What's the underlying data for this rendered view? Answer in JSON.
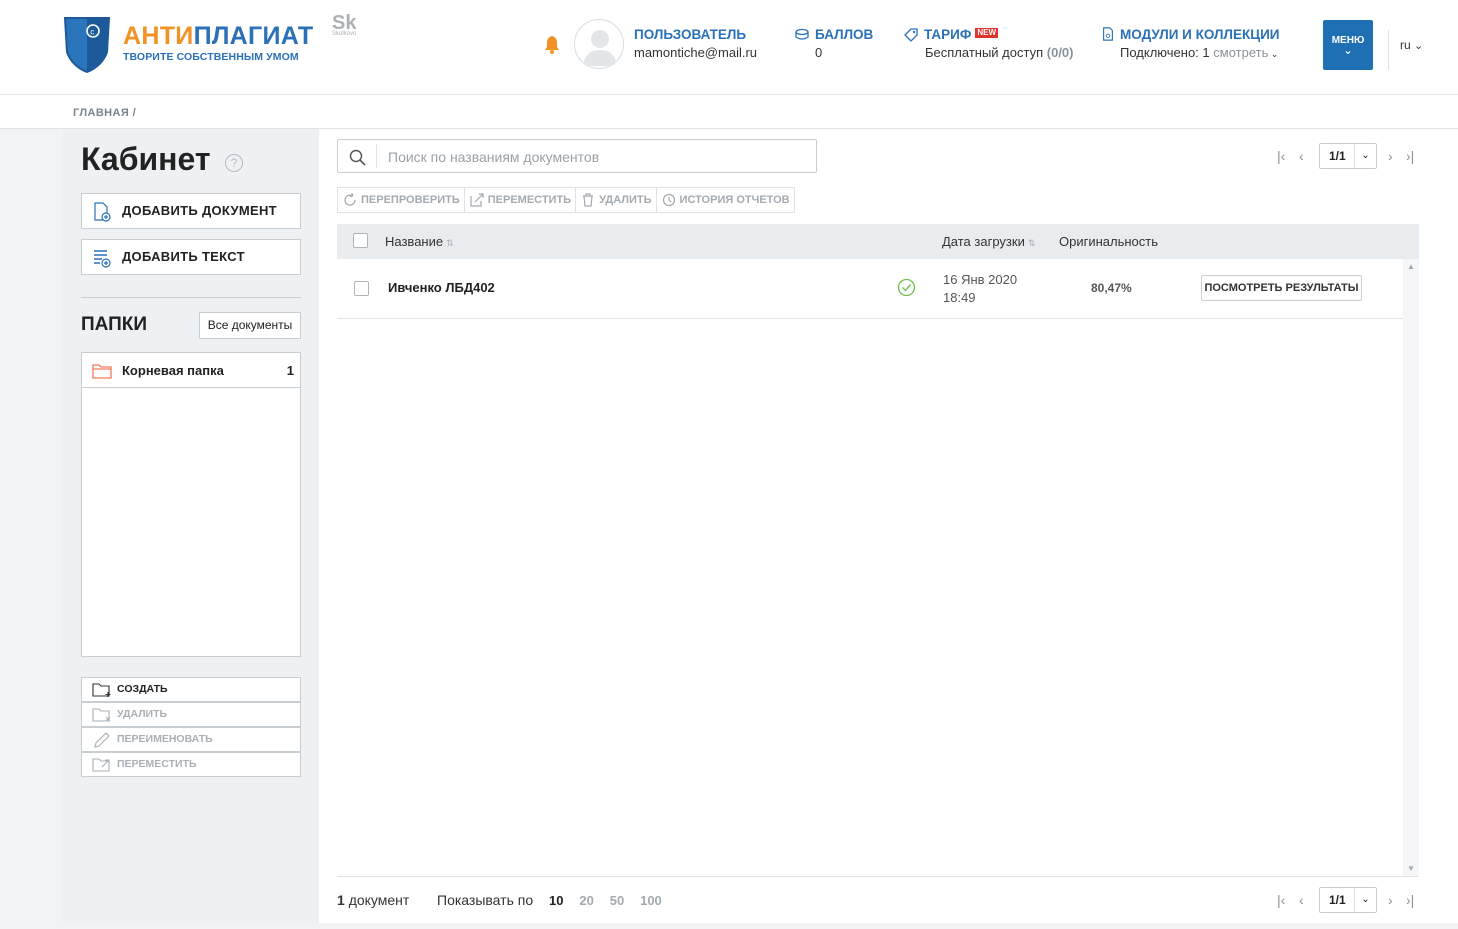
{
  "header": {
    "logo_part1": "АНТИ",
    "logo_part2": "ПЛАГИАТ",
    "logo_tagline": "ТВОРИТЕ СОБСТВЕННЫМ УМОМ",
    "skolkovo": "Sk",
    "skolkovo_sub": "Skolkovo",
    "user_label": "ПОЛЬЗОВАТЕЛЬ",
    "user_email": "mamontiche@mail.ru",
    "points_label": "БАЛЛОВ",
    "points_value": "0",
    "tariff_label": "ТАРИФ",
    "tariff_badge": "NEW",
    "tariff_value": "Бесплатный доступ",
    "tariff_count": "(0/0)",
    "modules_label": "МОДУЛИ И КОЛЛЕКЦИИ",
    "modules_value": "Подключено: 1",
    "modules_link": "смотреть",
    "menu_label": "МЕНЮ",
    "lang": "ru"
  },
  "breadcrumb": "ГЛАВНАЯ /",
  "sidebar": {
    "title": "Кабинет",
    "help": "?",
    "add_document": "ДОБАВИТЬ ДОКУМЕНТ",
    "add_text": "ДОБАВИТЬ ТЕКСТ",
    "folders_title": "ПАПКИ",
    "all_documents": "Все документы",
    "folders": [
      {
        "name": "Корневая папка",
        "count": "1"
      }
    ],
    "folder_actions": [
      "СОЗДАТЬ",
      "УДАЛИТЬ",
      "ПЕРЕИМЕНОВАТЬ",
      "ПЕРЕМЕСТИТЬ"
    ]
  },
  "main": {
    "search_placeholder": "Поиск по названиям документов",
    "page_indicator": "1/1",
    "actions": [
      "ПЕРЕПРОВЕРИТЬ",
      "ПЕРЕМЕСТИТЬ",
      "УДАЛИТЬ",
      "ИСТОРИЯ ОТЧЕТОВ"
    ],
    "columns": {
      "name": "Название",
      "date": "Дата загрузки",
      "originality": "Оригинальность"
    },
    "rows": [
      {
        "name": "Ивченко ЛБД402",
        "date": "16 Янв 2020",
        "time": "18:49",
        "originality": "80,47%",
        "button": "ПОСМОТРЕТЬ РЕЗУЛЬТАТЫ"
      }
    ],
    "footer_count_num": "1",
    "footer_count_word": "документ",
    "per_page_label": "Показывать по",
    "per_page_options": [
      "10",
      "20",
      "50",
      "100"
    ]
  },
  "colors": {
    "brand_blue": "#2a71b8",
    "brand_orange": "#f29225",
    "menu_blue": "#1f6fb5",
    "success_green": "#6cc04a"
  }
}
